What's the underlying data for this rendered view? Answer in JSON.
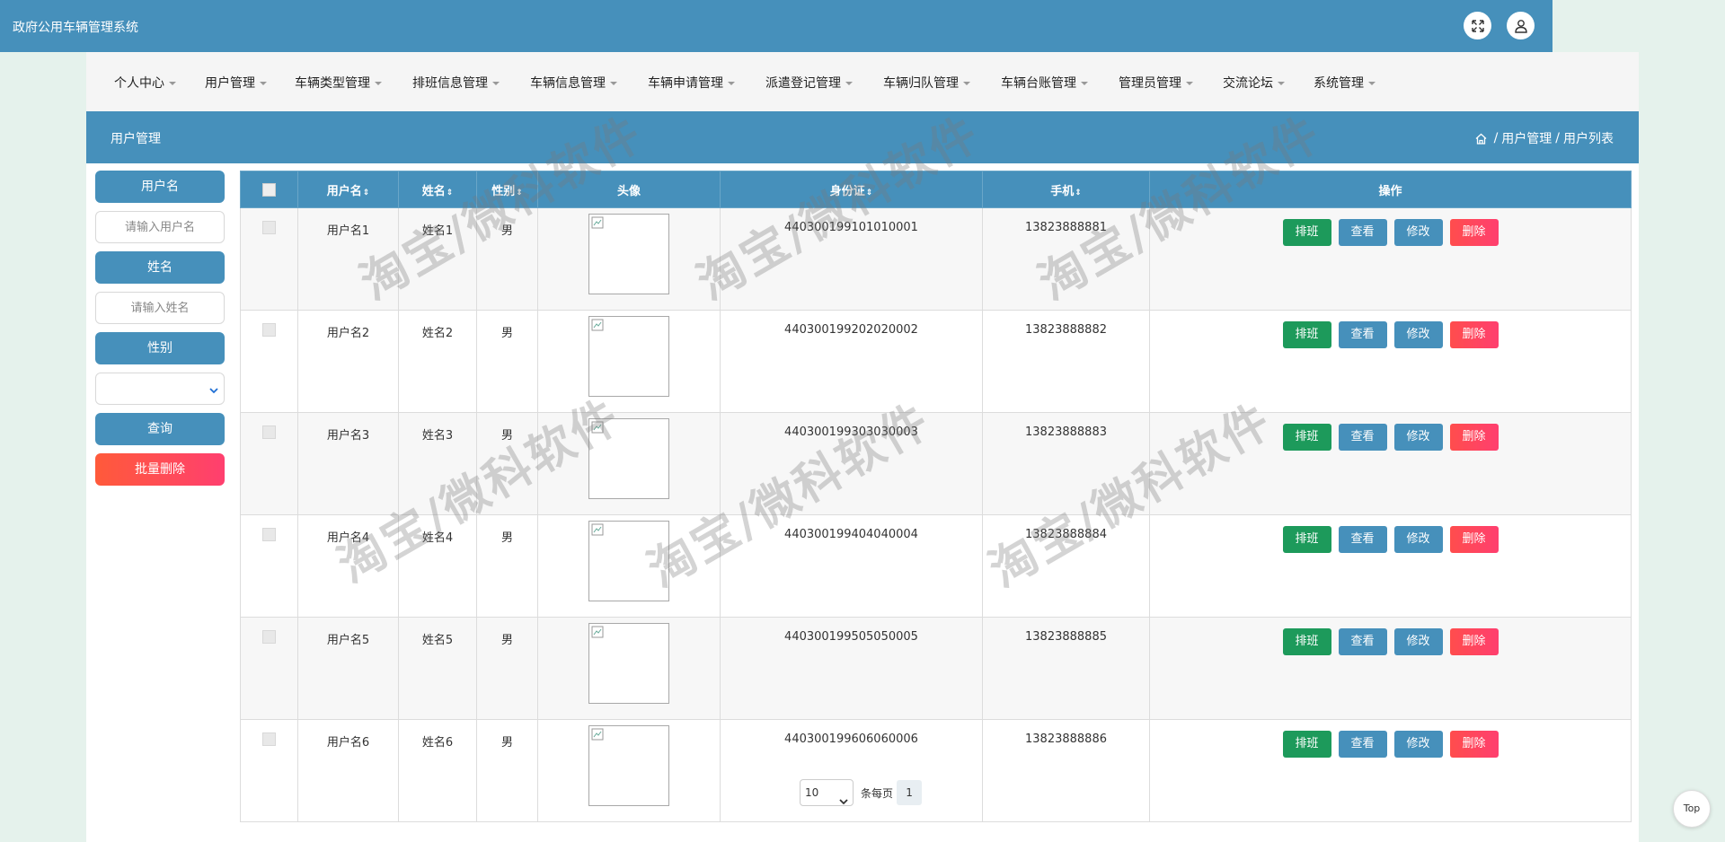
{
  "app": {
    "title": "政府公用车辆管理系统"
  },
  "header_icons": {
    "fullscreen": "fullscreen-icon",
    "user": "user-icon"
  },
  "nav": {
    "items": [
      {
        "label": "个人中心"
      },
      {
        "label": "用户管理"
      },
      {
        "label": "车辆类型管理"
      },
      {
        "label": "排班信息管理"
      },
      {
        "label": "车辆信息管理"
      },
      {
        "label": "车辆申请管理"
      },
      {
        "label": "派遣登记管理"
      },
      {
        "label": "车辆归队管理"
      },
      {
        "label": "车辆台账管理"
      },
      {
        "label": "管理员管理"
      },
      {
        "label": "交流论坛"
      },
      {
        "label": "系统管理"
      }
    ]
  },
  "section": {
    "title": "用户管理",
    "breadcrumb": [
      "用户管理",
      "用户列表"
    ],
    "breadcrumb_sep": "/"
  },
  "search": {
    "username_label": "用户名",
    "username_placeholder": "请输入用户名",
    "name_label": "姓名",
    "name_placeholder": "请输入姓名",
    "gender_label": "性别",
    "gender_value": "",
    "query_button": "查询",
    "batch_delete_button": "批量删除"
  },
  "table": {
    "headers": {
      "username": "用户名",
      "name": "姓名",
      "gender": "性别",
      "avatar": "头像",
      "id_card": "身份证",
      "phone": "手机",
      "actions": "操作"
    },
    "sort_glyph": "⇕",
    "rows": [
      {
        "username": "用户名1",
        "name": "姓名1",
        "gender": "男",
        "id_card": "440300199101010001",
        "phone": "13823888881"
      },
      {
        "username": "用户名2",
        "name": "姓名2",
        "gender": "男",
        "id_card": "440300199202020002",
        "phone": "13823888882"
      },
      {
        "username": "用户名3",
        "name": "姓名3",
        "gender": "男",
        "id_card": "440300199303030003",
        "phone": "13823888883"
      },
      {
        "username": "用户名4",
        "name": "姓名4",
        "gender": "男",
        "id_card": "440300199404040004",
        "phone": "13823888884"
      },
      {
        "username": "用户名5",
        "name": "姓名5",
        "gender": "男",
        "id_card": "440300199505050005",
        "phone": "13823888885"
      },
      {
        "username": "用户名6",
        "name": "姓名6",
        "gender": "男",
        "id_card": "440300199606060006",
        "phone": "13823888886"
      }
    ],
    "actions": {
      "schedule": "排班",
      "view": "查看",
      "edit": "修改",
      "delete": "删除"
    }
  },
  "pagination": {
    "page_size": "10",
    "per_page_label": "条每页",
    "current_page": "1"
  },
  "watermark": {
    "text": "淘宝/微科软件"
  },
  "top_button": "Top",
  "colors": {
    "primary": "#4690bb",
    "success": "#1d9a5b",
    "danger": "#ff4d4d",
    "background": "#e5f2ec"
  }
}
